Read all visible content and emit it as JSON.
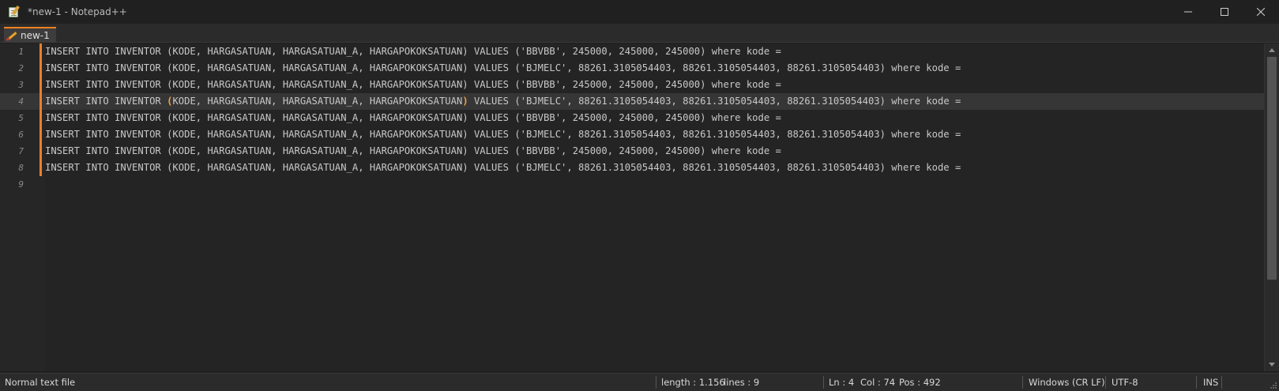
{
  "window": {
    "title": "*new-1 - Notepad++",
    "minimize_label": "—",
    "maximize_label": "☐",
    "close_label": "✕"
  },
  "tabs": [
    {
      "label": "new-1",
      "active": true,
      "unsaved": true
    }
  ],
  "editor": {
    "current_line": 4,
    "lines": [
      {
        "num": "1",
        "text": "INSERT INTO INVENTOR (KODE, HARGASATUAN, HARGASATUAN_A, HARGAPOKOKSATUAN) VALUES ('BBVBB', 245000, 245000, 245000) where kode ="
      },
      {
        "num": "2",
        "text": "INSERT INTO INVENTOR (KODE, HARGASATUAN, HARGASATUAN_A, HARGAPOKOKSATUAN) VALUES ('BJMELC', 88261.3105054403, 88261.3105054403, 88261.3105054403) where kode ="
      },
      {
        "num": "3",
        "text": "INSERT INTO INVENTOR (KODE, HARGASATUAN, HARGASATUAN_A, HARGAPOKOKSATUAN) VALUES ('BBVBB', 245000, 245000, 245000) where kode ="
      },
      {
        "num": "4",
        "pre": "INSERT INTO INVENTOR ",
        "brace_open": "(",
        "mid": "KODE, HARGASATUAN, HARGASATUAN_A, HARGAPOKOKSATUAN",
        "brace_close": ")",
        "post": " VALUES ('BJMELC', 88261.3105054403, 88261.3105054403, 88261.3105054403) where kode ="
      },
      {
        "num": "5",
        "text": "INSERT INTO INVENTOR (KODE, HARGASATUAN, HARGASATUAN_A, HARGAPOKOKSATUAN) VALUES ('BBVBB', 245000, 245000, 245000) where kode ="
      },
      {
        "num": "6",
        "text": "INSERT INTO INVENTOR (KODE, HARGASATUAN, HARGASATUAN_A, HARGAPOKOKSATUAN) VALUES ('BJMELC', 88261.3105054403, 88261.3105054403, 88261.3105054403) where kode ="
      },
      {
        "num": "7",
        "text": "INSERT INTO INVENTOR (KODE, HARGASATUAN, HARGASATUAN_A, HARGAPOKOKSATUAN) VALUES ('BBVBB', 245000, 245000, 245000) where kode ="
      },
      {
        "num": "8",
        "text": "INSERT INTO INVENTOR (KODE, HARGASATUAN, HARGASATUAN_A, HARGAPOKOKSATUAN) VALUES ('BJMELC', 88261.3105054403, 88261.3105054403, 88261.3105054403) where kode ="
      },
      {
        "num": "9",
        "text": ""
      }
    ]
  },
  "statusbar": {
    "file_type": "Normal text file",
    "length": "length : 1.156",
    "lines": "lines : 9",
    "ln": "Ln : 4",
    "col": "Col : 74",
    "pos": "Pos : 492",
    "eol": "Windows (CR LF)",
    "encoding": "UTF-8",
    "mode": "INS"
  },
  "colors": {
    "accent": "#f58220",
    "change_marker": "#e8802b",
    "brace_highlight": "#f0a341",
    "background": "#242424",
    "current_line": "#363636"
  },
  "icons": {
    "app": "notepad-plus-plus-icon",
    "tab": "pencil-unsaved-icon",
    "minimize": "minimize-icon",
    "maximize": "maximize-icon",
    "close": "close-icon"
  }
}
